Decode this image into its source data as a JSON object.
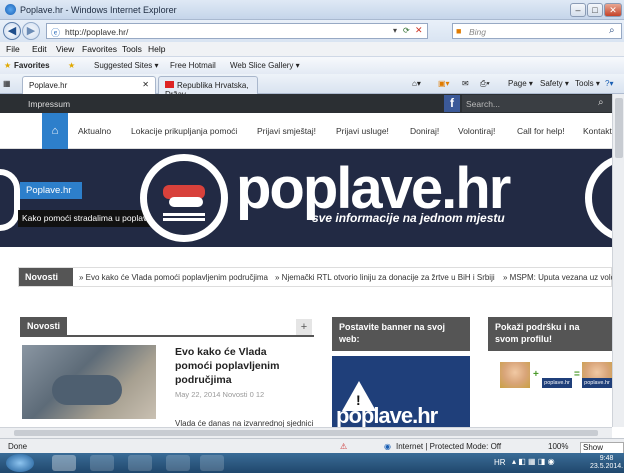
{
  "window": {
    "title": "Poplave.hr - Windows Internet Explorer",
    "min": "–",
    "max": "□",
    "close": "✕"
  },
  "address": {
    "url": "http://poplave.hr/",
    "search_placeholder": "Bing"
  },
  "menu": [
    "File",
    "Edit",
    "View",
    "Favorites",
    "Tools",
    "Help"
  ],
  "favorites": {
    "label": "Favorites",
    "items": [
      "Suggested Sites ▾",
      "Free Hotmail",
      "Web Slice Gallery ▾"
    ]
  },
  "tabs": [
    {
      "label": "Poplave.hr"
    },
    {
      "label": "Republika Hrvatska, Držav..."
    }
  ],
  "commandbar": [
    "Page ▾",
    "Safety ▾",
    "Tools ▾"
  ],
  "site": {
    "topbar": {
      "impressum": "Impressum",
      "fb": "f",
      "search_placeholder": "Search..."
    },
    "nav": [
      "Aktualno",
      "Lokacije prikupljanja pomoći",
      "Prijavi smještaj!",
      "Prijavi usluge!",
      "Doniraj!",
      "Volontiraj!",
      "Call for help!",
      "Kontakt"
    ],
    "hero": {
      "label": "Poplave.hr",
      "caption": "Kako pomoći stradalima u poplavama?",
      "logo": "poplave.hr",
      "tagline": "sve informacije na jednom mjestu"
    },
    "ticker": {
      "label": "Novosti",
      "items": [
        "» Evo kako će Vlada pomoći poplavljenim područjima",
        "» Njemački RTL otvorio liniju za donacije za žrtve u BiH i Srbiji",
        "» MSPM: Uputa vezana uz volonti"
      ]
    },
    "news": {
      "header": "Novosti",
      "plus": "+",
      "title": "Evo kako će Vlada pomoći poplavljenim područjima",
      "meta": "May 22, 2014   Novosti   0   12",
      "body": "Vlada će danas na izvanrednoj sjednici"
    },
    "banner": {
      "header": "Postavite banner na svoj web:",
      "text": "poplave.hr"
    },
    "support": {
      "header": "Pokaži podršku i na svom profilu!",
      "plus": "+",
      "eq": "=",
      "mini": "poplave.hr"
    }
  },
  "status": {
    "left": "Done",
    "zone": "Internet | Protected Mode: Off",
    "zoom": "100%",
    "tooltip": "Show deskto"
  },
  "taskbar": {
    "lang": "HR",
    "time": "9:48",
    "date": "23.5.2014."
  }
}
